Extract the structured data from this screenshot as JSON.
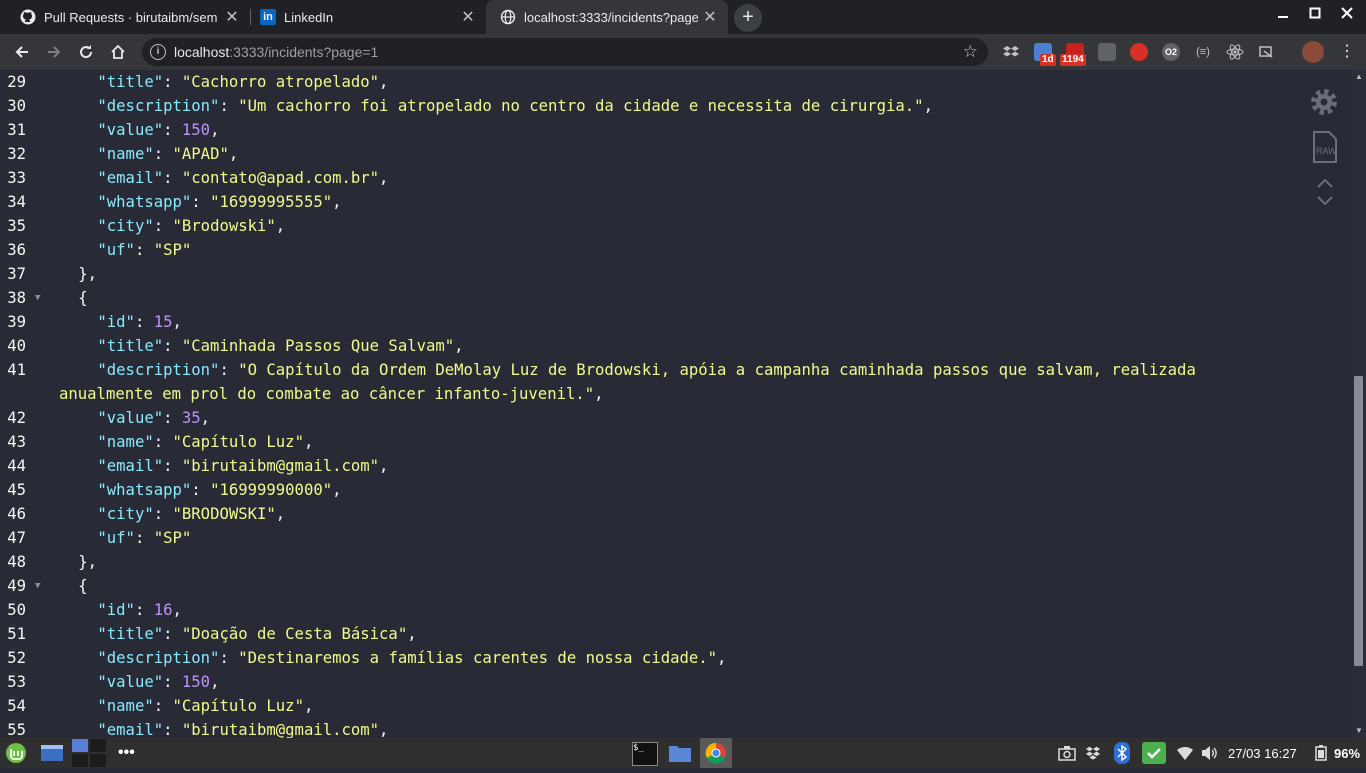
{
  "browser": {
    "tabs": [
      {
        "title": "Pull Requests · birutaibm/sem",
        "icon": "github-icon",
        "active": false
      },
      {
        "title": "LinkedIn",
        "icon": "linkedin-icon",
        "active": false
      },
      {
        "title": "localhost:3333/incidents?page=1",
        "icon": "globe-icon",
        "active": true
      }
    ],
    "close_glyph": "✕",
    "new_tab_glyph": "+",
    "address": {
      "host": "localhost",
      "path": ":3333/incidents?page=1"
    },
    "extensions": {
      "badge_1": "1d",
      "badge_2": "1194",
      "icon_text": "O2"
    },
    "colors": {
      "tab_strip": "#202124",
      "toolbar": "#35363a",
      "omnibox": "#202124"
    }
  },
  "json_viewer": {
    "colors": {
      "background": "#282a36",
      "key": "#8be9fd",
      "string": "#f1fa8c",
      "number": "#bd93f9",
      "punct": "#f8f8f2"
    },
    "lines": [
      {
        "n": "29",
        "indent": 2,
        "tokens": [
          {
            "t": "k",
            "v": "\"title\""
          },
          {
            "t": "p",
            "v": ": "
          },
          {
            "t": "s",
            "v": "\"Cachorro atropelado\""
          },
          {
            "t": "p",
            "v": ","
          }
        ]
      },
      {
        "n": "30",
        "indent": 2,
        "tokens": [
          {
            "t": "k",
            "v": "\"description\""
          },
          {
            "t": "p",
            "v": ": "
          },
          {
            "t": "s",
            "v": "\"Um cachorro foi atropelado no centro da cidade e necessita de cirurgia.\""
          },
          {
            "t": "p",
            "v": ","
          }
        ]
      },
      {
        "n": "31",
        "indent": 2,
        "tokens": [
          {
            "t": "k",
            "v": "\"value\""
          },
          {
            "t": "p",
            "v": ": "
          },
          {
            "t": "n",
            "v": "150"
          },
          {
            "t": "p",
            "v": ","
          }
        ]
      },
      {
        "n": "32",
        "indent": 2,
        "tokens": [
          {
            "t": "k",
            "v": "\"name\""
          },
          {
            "t": "p",
            "v": ": "
          },
          {
            "t": "s",
            "v": "\"APAD\""
          },
          {
            "t": "p",
            "v": ","
          }
        ]
      },
      {
        "n": "33",
        "indent": 2,
        "tokens": [
          {
            "t": "k",
            "v": "\"email\""
          },
          {
            "t": "p",
            "v": ": "
          },
          {
            "t": "s",
            "v": "\"contato@apad.com.br\""
          },
          {
            "t": "p",
            "v": ","
          }
        ]
      },
      {
        "n": "34",
        "indent": 2,
        "tokens": [
          {
            "t": "k",
            "v": "\"whatsapp\""
          },
          {
            "t": "p",
            "v": ": "
          },
          {
            "t": "s",
            "v": "\"16999995555\""
          },
          {
            "t": "p",
            "v": ","
          }
        ]
      },
      {
        "n": "35",
        "indent": 2,
        "tokens": [
          {
            "t": "k",
            "v": "\"city\""
          },
          {
            "t": "p",
            "v": ": "
          },
          {
            "t": "s",
            "v": "\"Brodowski\""
          },
          {
            "t": "p",
            "v": ","
          }
        ]
      },
      {
        "n": "36",
        "indent": 2,
        "tokens": [
          {
            "t": "k",
            "v": "\"uf\""
          },
          {
            "t": "p",
            "v": ": "
          },
          {
            "t": "s",
            "v": "\"SP\""
          }
        ]
      },
      {
        "n": "37",
        "indent": 1,
        "tokens": [
          {
            "t": "p",
            "v": "},"
          }
        ]
      },
      {
        "n": "38",
        "indent": 1,
        "fold": true,
        "tokens": [
          {
            "t": "p",
            "v": "{"
          }
        ]
      },
      {
        "n": "39",
        "indent": 2,
        "tokens": [
          {
            "t": "k",
            "v": "\"id\""
          },
          {
            "t": "p",
            "v": ": "
          },
          {
            "t": "n",
            "v": "15"
          },
          {
            "t": "p",
            "v": ","
          }
        ]
      },
      {
        "n": "40",
        "indent": 2,
        "tokens": [
          {
            "t": "k",
            "v": "\"title\""
          },
          {
            "t": "p",
            "v": ": "
          },
          {
            "t": "s",
            "v": "\"Caminhada Passos Que Salvam\""
          },
          {
            "t": "p",
            "v": ","
          }
        ]
      },
      {
        "n": "41",
        "indent": 2,
        "tokens": [
          {
            "t": "k",
            "v": "\"description\""
          },
          {
            "t": "p",
            "v": ": "
          },
          {
            "t": "s",
            "v": "\"O Capítulo da Ordem DeMolay Luz de Brodowski, apóia a campanha caminhada passos que salvam, realizada"
          }
        ]
      },
      {
        "n": "",
        "indent": 0,
        "tokens": [
          {
            "t": "s",
            "v": "anualmente em prol do combate ao câncer infanto-juvenil.\""
          },
          {
            "t": "p",
            "v": ","
          }
        ]
      },
      {
        "n": "42",
        "indent": 2,
        "tokens": [
          {
            "t": "k",
            "v": "\"value\""
          },
          {
            "t": "p",
            "v": ": "
          },
          {
            "t": "n",
            "v": "35"
          },
          {
            "t": "p",
            "v": ","
          }
        ]
      },
      {
        "n": "43",
        "indent": 2,
        "tokens": [
          {
            "t": "k",
            "v": "\"name\""
          },
          {
            "t": "p",
            "v": ": "
          },
          {
            "t": "s",
            "v": "\"Capítulo Luz\""
          },
          {
            "t": "p",
            "v": ","
          }
        ]
      },
      {
        "n": "44",
        "indent": 2,
        "tokens": [
          {
            "t": "k",
            "v": "\"email\""
          },
          {
            "t": "p",
            "v": ": "
          },
          {
            "t": "s",
            "v": "\"birutaibm@gmail.com\""
          },
          {
            "t": "p",
            "v": ","
          }
        ]
      },
      {
        "n": "45",
        "indent": 2,
        "tokens": [
          {
            "t": "k",
            "v": "\"whatsapp\""
          },
          {
            "t": "p",
            "v": ": "
          },
          {
            "t": "s",
            "v": "\"16999990000\""
          },
          {
            "t": "p",
            "v": ","
          }
        ]
      },
      {
        "n": "46",
        "indent": 2,
        "tokens": [
          {
            "t": "k",
            "v": "\"city\""
          },
          {
            "t": "p",
            "v": ": "
          },
          {
            "t": "s",
            "v": "\"BRODOWSKI\""
          },
          {
            "t": "p",
            "v": ","
          }
        ]
      },
      {
        "n": "47",
        "indent": 2,
        "tokens": [
          {
            "t": "k",
            "v": "\"uf\""
          },
          {
            "t": "p",
            "v": ": "
          },
          {
            "t": "s",
            "v": "\"SP\""
          }
        ]
      },
      {
        "n": "48",
        "indent": 1,
        "tokens": [
          {
            "t": "p",
            "v": "},"
          }
        ]
      },
      {
        "n": "49",
        "indent": 1,
        "fold": true,
        "tokens": [
          {
            "t": "p",
            "v": "{"
          }
        ]
      },
      {
        "n": "50",
        "indent": 2,
        "tokens": [
          {
            "t": "k",
            "v": "\"id\""
          },
          {
            "t": "p",
            "v": ": "
          },
          {
            "t": "n",
            "v": "16"
          },
          {
            "t": "p",
            "v": ","
          }
        ]
      },
      {
        "n": "51",
        "indent": 2,
        "tokens": [
          {
            "t": "k",
            "v": "\"title\""
          },
          {
            "t": "p",
            "v": ": "
          },
          {
            "t": "s",
            "v": "\"Doação de Cesta Básica\""
          },
          {
            "t": "p",
            "v": ","
          }
        ]
      },
      {
        "n": "52",
        "indent": 2,
        "tokens": [
          {
            "t": "k",
            "v": "\"description\""
          },
          {
            "t": "p",
            "v": ": "
          },
          {
            "t": "s",
            "v": "\"Destinaremos a famílias carentes de nossa cidade.\""
          },
          {
            "t": "p",
            "v": ","
          }
        ]
      },
      {
        "n": "53",
        "indent": 2,
        "tokens": [
          {
            "t": "k",
            "v": "\"value\""
          },
          {
            "t": "p",
            "v": ": "
          },
          {
            "t": "n",
            "v": "150"
          },
          {
            "t": "p",
            "v": ","
          }
        ]
      },
      {
        "n": "54",
        "indent": 2,
        "tokens": [
          {
            "t": "k",
            "v": "\"name\""
          },
          {
            "t": "p",
            "v": ": "
          },
          {
            "t": "s",
            "v": "\"Capítulo Luz\""
          },
          {
            "t": "p",
            "v": ","
          }
        ]
      },
      {
        "n": "55",
        "indent": 2,
        "tokens": [
          {
            "t": "k",
            "v": "\"email\""
          },
          {
            "t": "p",
            "v": ": "
          },
          {
            "t": "s",
            "v": "\"birutaibm@gmail.com\""
          },
          {
            "t": "p",
            "v": ","
          }
        ]
      }
    ],
    "tools": {
      "raw_label": "RAW"
    }
  },
  "taskbar": {
    "clock": "27/03 16:27",
    "battery": "96%",
    "terminal_label": "$_"
  }
}
